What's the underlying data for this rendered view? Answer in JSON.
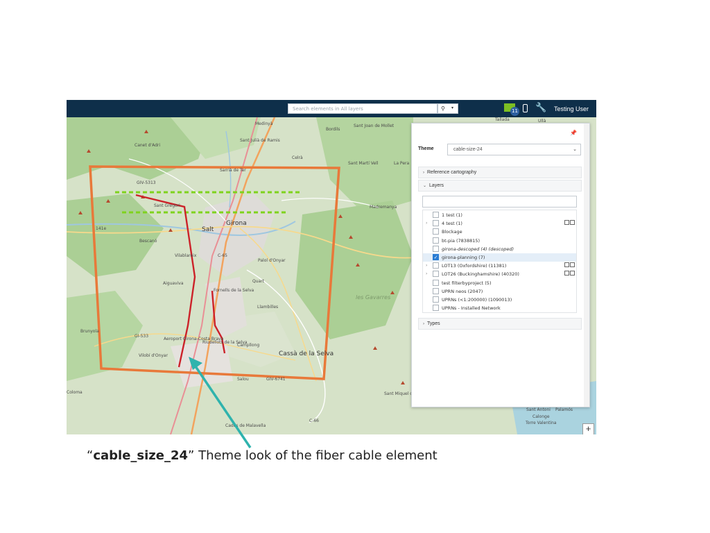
{
  "topbar": {
    "search_placeholder": "Search elements in All layers",
    "mail_count": "11",
    "user_name": "Testing User"
  },
  "map_labels": {
    "places": [
      "Medinyà",
      "Sant Julià de Ramis",
      "Bordils",
      "Sant Joan de Mollet",
      "Celrà",
      "Canet d'Adri",
      "Sarrià de Ter",
      "Sant Martí Vell",
      "La Pera",
      "GIV-5313",
      "Sant Gregori",
      "Madremanya",
      "Salt",
      "Girona",
      "Bescanó",
      "Palol d'Onyar",
      "Vilablareix",
      "Quart",
      "Aiguaviva",
      "Fornells de la Selva",
      "Llambilles",
      "Brunyola",
      "GI-533",
      "Aeroport Girona-Costa Brava",
      "Riudellots de la Selva",
      "Campllong",
      "Vilobí d'Onyar",
      "Cassà de la Selva",
      "Salou",
      "GIV-6741",
      "Sant Miquel d'Aro",
      "Coloma",
      "Cadés de Malavella",
      "C-65",
      "C-66",
      "Sant Antoni",
      "Calonge",
      "Torre Valentina",
      "Palamós",
      "Tallada",
      "Ullà",
      "141e"
    ],
    "region": "les Gavarres"
  },
  "panel": {
    "theme_label": "Theme",
    "theme_value": "cable-size-24",
    "sections": {
      "reference": "Reference cartography",
      "layers": "Layers",
      "types": "Types"
    },
    "layers": [
      {
        "name": "1 test (1)",
        "checked": false,
        "expandable": false
      },
      {
        "name": "4 test (1)",
        "checked": false,
        "expandable": true
      },
      {
        "name": "Blockage",
        "checked": false,
        "expandable": false
      },
      {
        "name": "bt-pia (7838815)",
        "checked": false,
        "expandable": false
      },
      {
        "name": "girona-descoped (4) (descoped)",
        "checked": false,
        "expandable": false
      },
      {
        "name": "girona-planning (7)",
        "checked": true,
        "expandable": false
      },
      {
        "name": "LOT13 (Oxfordshire) (11381)",
        "checked": false,
        "expandable": true
      },
      {
        "name": "LOT26 (Buckinghamshire) (40320)",
        "checked": false,
        "expandable": true
      },
      {
        "name": "test filterbyproject (5)",
        "checked": false,
        "expandable": false
      },
      {
        "name": "UPRN neos (2047)",
        "checked": false,
        "expandable": false
      },
      {
        "name": "UPRNs (<1:200000) (1090013)",
        "checked": false,
        "expandable": false
      },
      {
        "name": "UPRNs - Installed Network",
        "checked": false,
        "expandable": false
      }
    ]
  },
  "zoom_in": "+",
  "caption": {
    "open_quote": "“",
    "bold": "cable_size_24",
    "rest": "” Theme look of the fiber cable element"
  },
  "colors": {
    "topbar": "#0e2f4a",
    "rectangle": "#e8793a",
    "cable": "#cc2229",
    "dashed": "#7fd31d",
    "arrow": "#2fb3ad"
  }
}
